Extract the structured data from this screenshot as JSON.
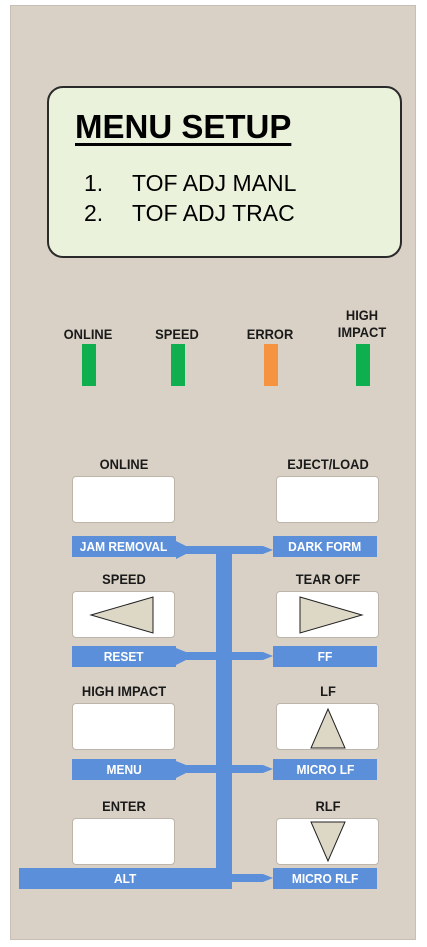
{
  "display": {
    "title": "MENU SETUP",
    "lines": [
      {
        "num": "1.",
        "text": "TOF ADJ MANL"
      },
      {
        "num": "2.",
        "text": "TOF ADJ TRAC"
      }
    ]
  },
  "indicators": [
    {
      "label": "ONLINE",
      "color": "#0fae4f"
    },
    {
      "label": "SPEED",
      "color": "#0fae4f"
    },
    {
      "label": "ERROR",
      "color": "#f59340"
    },
    {
      "label": "HIGH\nIMPACT",
      "color": "#0fae4f"
    }
  ],
  "keys": {
    "online": "ONLINE",
    "eject_load": "EJECT/LOAD",
    "speed": "SPEED",
    "tear_off": "TEAR OFF",
    "high_impact": "HIGH IMPACT",
    "lf": "LF",
    "enter": "ENTER",
    "rlf": "RLF"
  },
  "alt_functions": {
    "jam_removal": "JAM REMOVAL",
    "dark_form": "DARK FORM",
    "reset": "RESET",
    "ff": "FF",
    "menu": "MENU",
    "micro_lf": "MICRO LF",
    "alt": "ALT",
    "micro_rlf": "MICRO RLF"
  },
  "colors": {
    "panel": "#d9d1c6",
    "lcd": "#ebf2dc",
    "function_bar": "#5b8fd9",
    "arrow_fill": "#ddd7c6"
  }
}
